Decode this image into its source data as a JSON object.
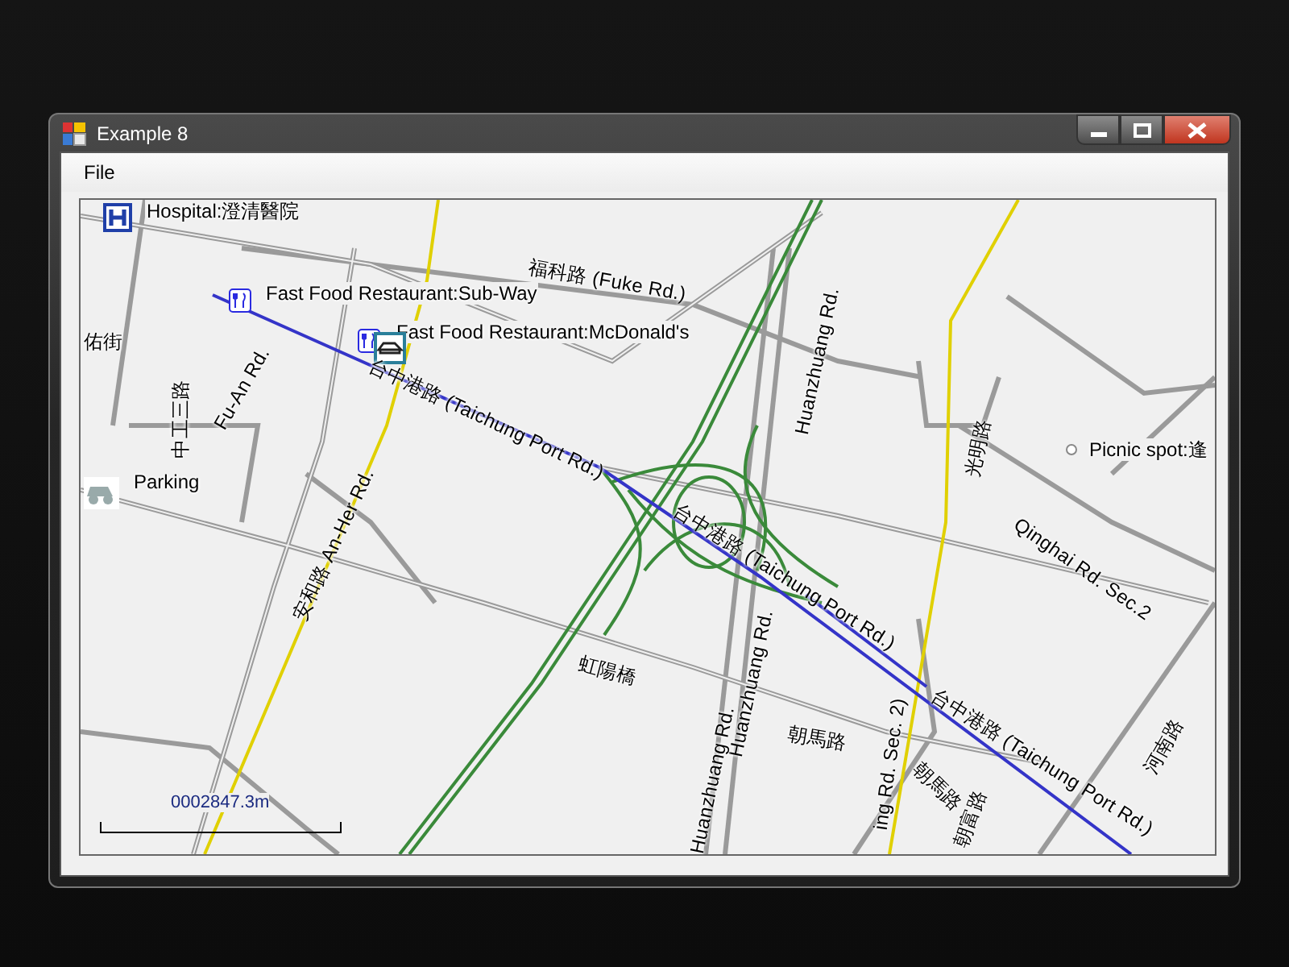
{
  "window": {
    "title": "Example 8"
  },
  "menu": [
    {
      "label": "File"
    }
  ],
  "map": {
    "pois": [
      {
        "kind": "hospital",
        "label": "Hospital:澄清醫院"
      },
      {
        "kind": "restaurant",
        "label": "Fast Food Restaurant:Sub-Way"
      },
      {
        "kind": "restaurant",
        "label": "Fast Food Restaurant:McDonald's"
      },
      {
        "kind": "parking",
        "label": "Parking"
      },
      {
        "kind": "picnic",
        "label": "Picnic spot:逢"
      }
    ],
    "road_labels": [
      {
        "text": "福科路 (Fuke Rd.)"
      },
      {
        "text": "佑街"
      },
      {
        "text": "中工三路"
      },
      {
        "text": "Fu-An Rd."
      },
      {
        "text": "台中港路 (Taichung Port Rd.)"
      },
      {
        "text": "安和路 An-Her Rd."
      },
      {
        "text": "Huanzhuang Rd."
      },
      {
        "text": "光明路"
      },
      {
        "text": "台中港路 (Taichung Port Rd.)"
      },
      {
        "text": "Huanzhuang Rd."
      },
      {
        "text": "Qinghai Rd. Sec.2"
      },
      {
        "text": "虹陽橋"
      },
      {
        "text": "台中港路 (Taichung Port Rd.)"
      },
      {
        "text": "朝馬路"
      },
      {
        "text": "河南路"
      },
      {
        "text": "Huanzhuang Rd."
      },
      {
        "text": "ing Rd. Sec. 2)"
      },
      {
        "text": "朝馬路"
      },
      {
        "text": "朝富路"
      }
    ],
    "scale": "0002847.3m"
  }
}
